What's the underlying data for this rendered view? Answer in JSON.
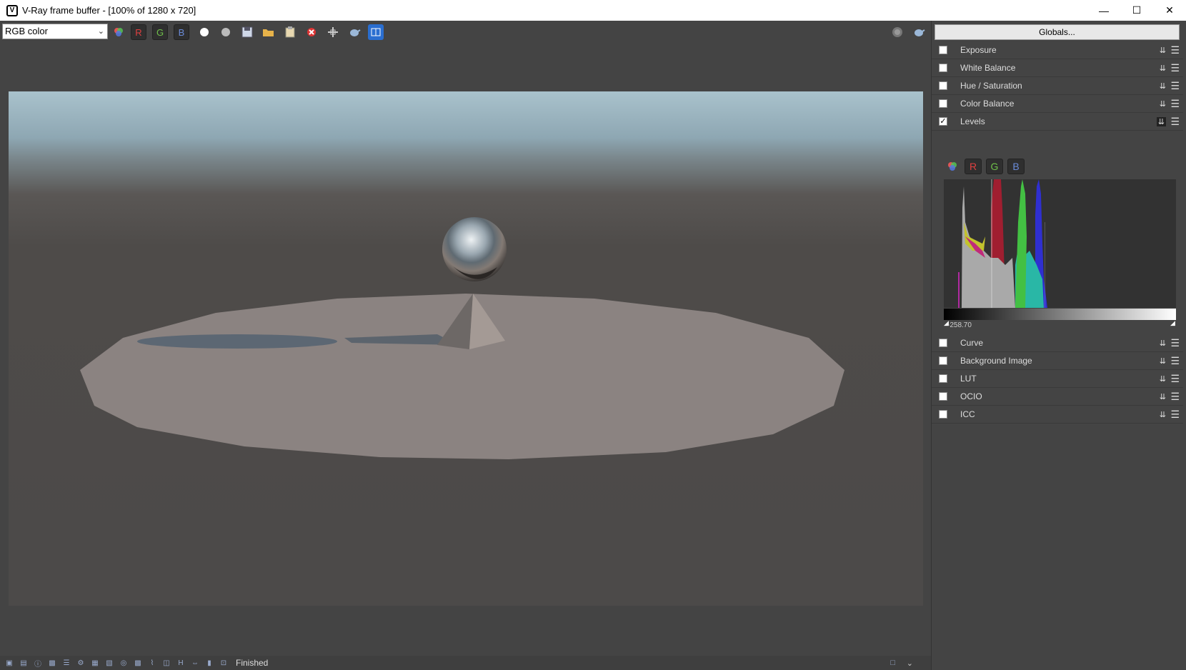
{
  "window": {
    "title": "V-Ray frame buffer - [100% of 1280 x 720]",
    "controls": [
      "minimize",
      "maximize",
      "close"
    ]
  },
  "toolbar": {
    "channel_select": "RGB color",
    "r_label": "R",
    "g_label": "G",
    "b_label": "B",
    "icons": [
      "color-channels-icon",
      "white-point-icon",
      "mono-icon",
      "save-icon",
      "open-icon",
      "clipboard-icon",
      "clear-icon",
      "region-icon",
      "render-teapot-icon",
      "compare-icon"
    ]
  },
  "panel": {
    "globals_label": "Globals...",
    "layers": [
      {
        "label": "Exposure",
        "checked": false
      },
      {
        "label": "White Balance",
        "checked": false
      },
      {
        "label": "Hue / Saturation",
        "checked": false
      },
      {
        "label": "Color Balance",
        "checked": false
      },
      {
        "label": "Levels",
        "checked": true
      }
    ],
    "levels": {
      "r_label": "R",
      "g_label": "G",
      "b_label": "B",
      "value": "-258.70"
    },
    "layers_after": [
      {
        "label": "Curve",
        "checked": false
      },
      {
        "label": "Background Image",
        "checked": false
      },
      {
        "label": "LUT",
        "checked": false
      },
      {
        "label": "OCIO",
        "checked": false
      },
      {
        "label": "ICC",
        "checked": false
      }
    ]
  },
  "status": {
    "text": "Finished"
  },
  "colors": {
    "background": "#444444",
    "red": "#e04040",
    "green": "#6fc04a",
    "blue": "#6a8bd8"
  }
}
